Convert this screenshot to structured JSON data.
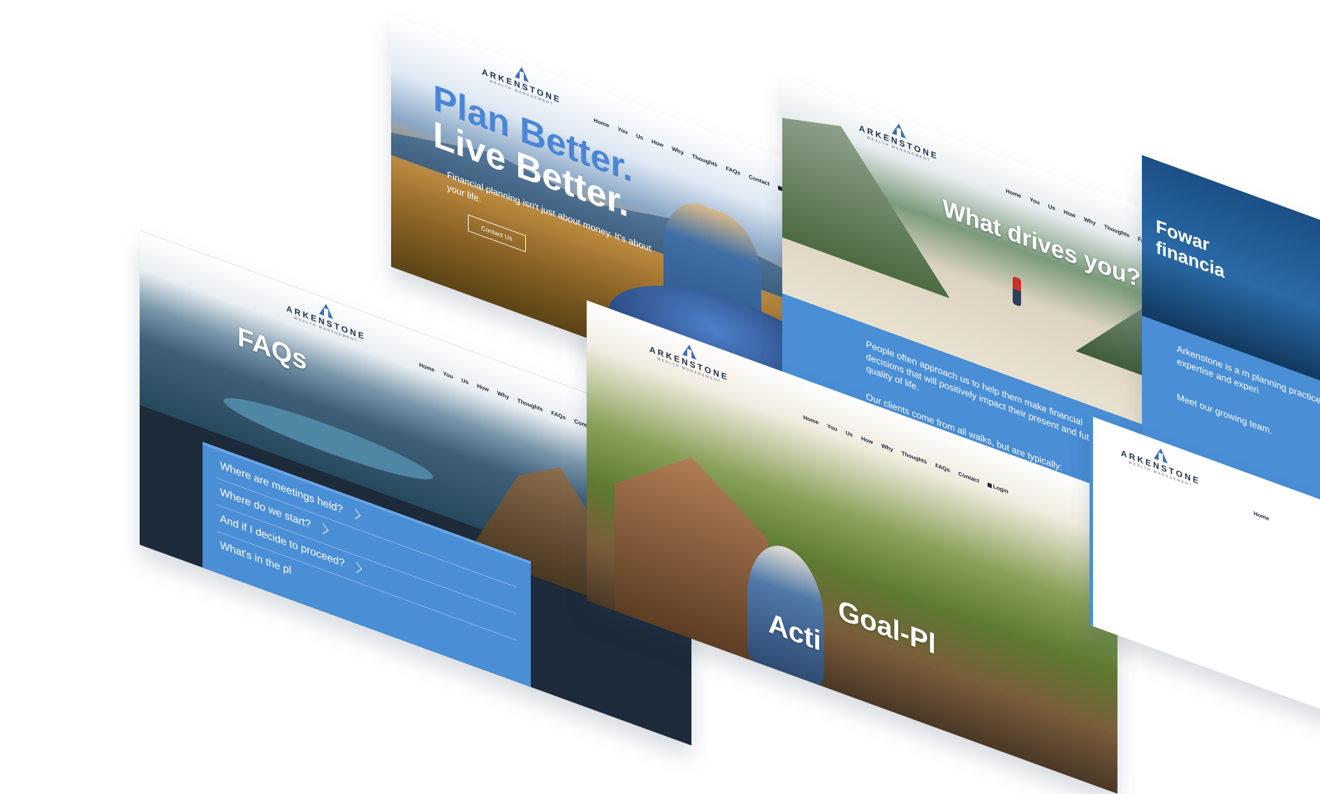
{
  "brand": {
    "name": "ARKENSTONE",
    "tagline": "WEALTH MANAGEMENT"
  },
  "nav": {
    "items": [
      "Home",
      "You",
      "Us",
      "How",
      "Why",
      "Thoughts",
      "FAQs",
      "Contact"
    ],
    "login": "Login"
  },
  "hero": {
    "line1": "Plan Better.",
    "line2": "Live Better.",
    "subtitle": "Financial planning isn't just about money. It's about your life.",
    "cta": "Contact Us"
  },
  "drives": {
    "title": "What drives you?",
    "paragraph": "People often approach us to help them make financial decisions that will positively impact their present and future quality of life.",
    "paragraph2": "Our clients come from all walks, but are typically:"
  },
  "forward": {
    "title_line1": "Fowar",
    "title_line2": "financia",
    "paragraph": "Arkenstone is a m planning practice b expertise and experi",
    "paragraph2": "Meet our growing team."
  },
  "faqs": {
    "title": "FAQs",
    "questions": [
      "Where are meetings held?",
      "Where do we start?",
      "And if I decide to proceed?",
      "What's in the pl"
    ]
  },
  "goal": {
    "title": "Goal-Pl",
    "title2": "Acti"
  },
  "bottom_right": {
    "nav_first": "Home"
  },
  "colors": {
    "accent_blue": "#4a8ed6",
    "hero_blue": "#4a86d6",
    "dark_navy": "#1c2a3a"
  }
}
